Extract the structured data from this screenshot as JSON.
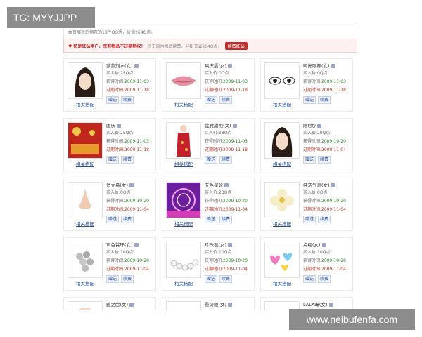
{
  "tag": "TG: MYYJJPP",
  "watermark": "www.neibufenfa.com",
  "info": "本页展示您拥有的18件QQ秀，价值264Q点。",
  "vip": {
    "strong": "您是红钻用户，享有物品不过期特权！",
    "sub": "您无需为物品续费，轻松节省264Q点。",
    "button": "续费红钻"
  },
  "labels": {
    "price": "买入价:",
    "acquired": "获得时间:",
    "expire": "过期时间:",
    "gift": "赠送",
    "renew": "续费",
    "match": "相关搭配"
  },
  "items": [
    {
      "name": "蒙蒙刘水(女)",
      "price": "25Q点",
      "acquired": "2009-11-03",
      "expire": "2009-11-18",
      "icon": "hair-icon"
    },
    {
      "name": "果冻唇(女)",
      "price": "0Q点",
      "acquired": "2009-11-03",
      "expire": "2009-11-18",
      "icon": "lips-icon"
    },
    {
      "name": "明亮眼神(女)",
      "price": "0Q点",
      "acquired": "2009-11-03",
      "expire": "2009-11-18",
      "icon": "eyes-icon"
    },
    {
      "name": "国庆",
      "price": "25Q点",
      "acquired": "2009-11-03",
      "expire": "2009-11-18",
      "icon": "celebration-icon"
    },
    {
      "name": "优雅旗袍(女)",
      "price": "38Q点",
      "acquired": "2009-11-03",
      "expire": "2009-11-18",
      "icon": "qipao-icon"
    },
    {
      "name": "随(女)",
      "price": "29Q点",
      "acquired": "2009-10-20",
      "expire": "2009-11-04",
      "icon": "hair-icon"
    },
    {
      "name": "俏立鼻(女)",
      "price": "0Q点",
      "acquired": "2009-10-20",
      "expire": "2009-11-04",
      "icon": "nose-icon"
    },
    {
      "name": "五色星轮",
      "price": "23Q点",
      "acquired": "2009-10-20",
      "expire": "2009-11-04",
      "icon": "star-wheel-icon"
    },
    {
      "name": "纯洁气息(女)",
      "price": "0Q点",
      "acquired": "2009-10-20",
      "expire": "2009-11-04",
      "icon": "flower-icon"
    },
    {
      "name": "灰色臂环(女)",
      "price": "10Q点",
      "acquired": "2009-10-20",
      "expire": "2009-11-04",
      "icon": "armlet-icon"
    },
    {
      "name": "珍珠链(女)",
      "price": "10Q点",
      "acquired": "2009-10-20",
      "expire": "2009-11-04",
      "icon": "pearl-icon"
    },
    {
      "name": "点缀(女)",
      "price": "10Q点",
      "acquired": "2009-10-20",
      "expire": "2009-11-04",
      "icon": "hearts-icon"
    },
    {
      "name": "瓢之脸(女)",
      "icon": "face-icon"
    },
    {
      "name": "重铸眼(女)",
      "icon": "eyes-icon"
    },
    {
      "name": "LALA嘴(女)",
      "icon": "lips-icon"
    }
  ]
}
